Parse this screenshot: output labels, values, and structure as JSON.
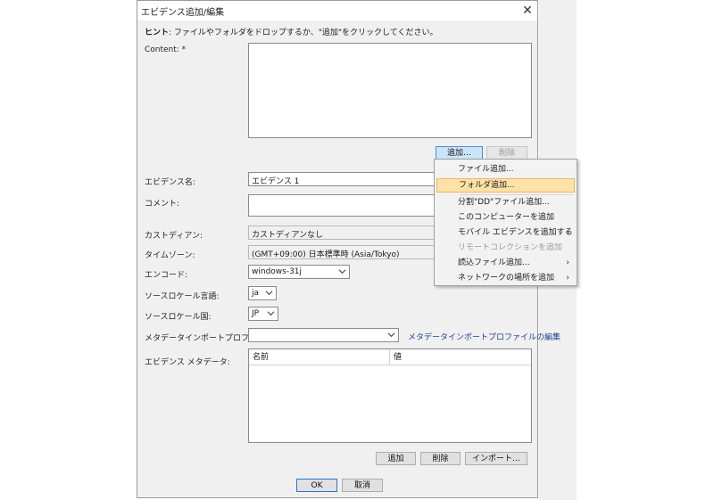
{
  "dialog": {
    "title": "エビデンス追加/編集",
    "close_glyph": "✕",
    "hint_bold": "ヒント",
    "hint_text": ": ファイルやフォルダをドロップするか、\"追加\"をクリックしてください。"
  },
  "content": {
    "label": "Content: *",
    "add_button": "追加…",
    "delete_button": "削除"
  },
  "fields": {
    "evidence_name_label": "エビデンス名:",
    "evidence_name_value": "エビデンス 1",
    "comment_label": "コメント:",
    "comment_value": "",
    "custodian_label": "カストディアン:",
    "custodian_value": "カストディアンなし",
    "timezone_label": "タイムゾーン:",
    "timezone_value": "(GMT+09:00) 日本標準時 (Asia/Tokyo)",
    "encoding_label": "エンコード:",
    "encoding_value": "windows-31j",
    "source_lang_label": "ソースロケール言語:",
    "source_lang_value": "ja",
    "source_country_label": "ソースロケール国:",
    "source_country_value": "JP",
    "metadata_profile_label": "メタデータインポートプロファイル",
    "metadata_profile_value": "",
    "metadata_profile_edit_link": "メタデータインポートプロファイルの編集"
  },
  "metadata": {
    "label": "エビデンス メタデータ:",
    "columns": [
      "名前",
      "値"
    ],
    "add_button": "追加",
    "delete_button": "削除",
    "import_button": "インポート…"
  },
  "footer": {
    "ok_button": "OK",
    "cancel_button": "取消"
  },
  "menu": {
    "items": [
      {
        "label": "ファイル追加...",
        "submenu": false,
        "disabled": false,
        "highlighted": false
      },
      {
        "label": "フォルダ追加...",
        "submenu": false,
        "disabled": false,
        "highlighted": true
      },
      {
        "label": "分割\"DD\"ファイル追加...",
        "submenu": false,
        "disabled": false,
        "highlighted": false
      },
      {
        "label": "このコンピューターを追加",
        "submenu": false,
        "disabled": false,
        "highlighted": false
      },
      {
        "label": "モバイル エビデンスを追加する",
        "submenu": true,
        "disabled": false,
        "highlighted": false
      },
      {
        "label": "リモートコレクションを追加",
        "submenu": false,
        "disabled": true,
        "highlighted": false
      },
      {
        "label": "読込ファイル追加...",
        "submenu": true,
        "disabled": false,
        "highlighted": false
      },
      {
        "label": "ネットワークの場所を追加",
        "submenu": true,
        "disabled": false,
        "highlighted": false
      }
    ],
    "submenu_arrow": "›"
  }
}
